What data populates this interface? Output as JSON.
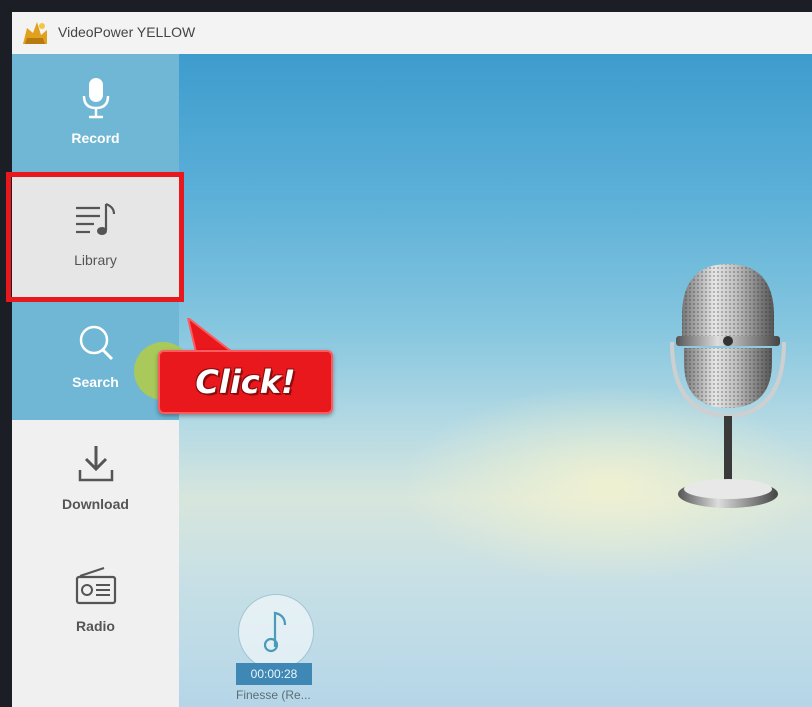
{
  "window": {
    "title": "VideoPower YELLOW"
  },
  "sidebar": {
    "items": [
      {
        "label": "Record",
        "icon": "microphone-icon",
        "active": true
      },
      {
        "label": "Library",
        "icon": "music-list-icon",
        "active": false
      },
      {
        "label": "Search",
        "icon": "search-icon",
        "active": true
      },
      {
        "label": "Download",
        "icon": "download-icon",
        "active": false
      },
      {
        "label": "Radio",
        "icon": "radio-icon",
        "active": false
      }
    ]
  },
  "annotation": {
    "callout_text": "Click!",
    "color": "#e8181d"
  },
  "player": {
    "time": "00:00:28",
    "track": "Finesse (Re..."
  },
  "colors": {
    "sidebar_active": "#6fb7d4",
    "time_badge": "#3f88b6"
  }
}
